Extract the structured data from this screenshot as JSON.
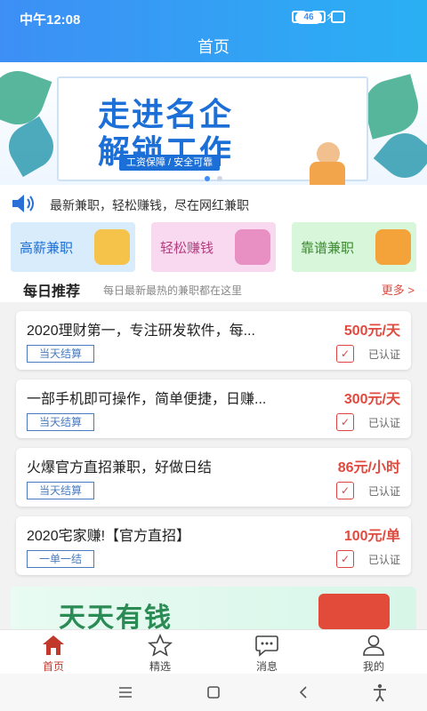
{
  "status": {
    "time": "中午12:08",
    "battery": "46"
  },
  "header": {
    "title": "首页"
  },
  "banner": {
    "line1": "走进名企",
    "line2": "解锁工作",
    "tag": "工资保障 / 安全可靠"
  },
  "notice": {
    "text": "最新兼职，轻松赚钱，尽在网红兼职"
  },
  "categories": [
    {
      "label": "高薪兼职",
      "color": "#d9ecfb",
      "text": "#1c6fd6"
    },
    {
      "label": "轻松赚钱",
      "color": "#f8d9ef",
      "text": "#b2407f"
    },
    {
      "label": "靠谱兼职",
      "color": "#d7f6da",
      "text": "#3b8a2f"
    }
  ],
  "daily": {
    "title": "每日推荐",
    "subtitle": "每日最新最热的兼职都在这里",
    "more": "更多 >"
  },
  "jobs": [
    {
      "title": "2020理财第一，专注研发软件，每...",
      "price": "500元/天",
      "badge": "当天结算",
      "verified": "已认证"
    },
    {
      "title": "一部手机即可操作，简单便捷，日赚...",
      "price": "300元/天",
      "badge": "当天结算",
      "verified": "已认证"
    },
    {
      "title": "火爆官方直招兼职，好做日结",
      "price": "86元/小时",
      "badge": "当天结算",
      "verified": "已认证"
    },
    {
      "title": "2020宅家赚!【官方直招】",
      "price": "100元/单",
      "badge": "一单一结",
      "verified": "已认证"
    }
  ],
  "promo": {
    "text": "天天有钱"
  },
  "tabs": [
    {
      "label": "首页",
      "icon": "home-icon",
      "active": true
    },
    {
      "label": "精选",
      "icon": "star-icon",
      "active": false
    },
    {
      "label": "消息",
      "icon": "message-icon",
      "active": false
    },
    {
      "label": "我的",
      "icon": "user-icon",
      "active": false
    }
  ],
  "colors": {
    "primary": "#3d8ff5",
    "accent_red": "#e04a3f",
    "tab_active": "#c0392b"
  }
}
